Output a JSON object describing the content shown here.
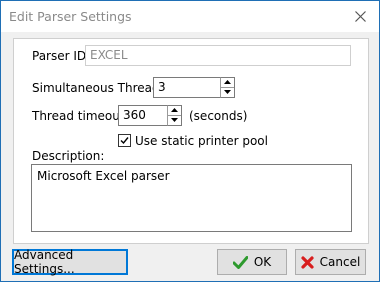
{
  "window": {
    "title": "Edit Parser Settings"
  },
  "icons": {
    "close": "close-icon",
    "ok": "check-icon",
    "cancel": "x-icon"
  },
  "colors": {
    "accent": "#0078d7",
    "ok_green": "#2e9a2e",
    "cancel_red": "#d81e1e"
  },
  "form": {
    "parser_id_label": "Parser ID:",
    "parser_id_value": "EXCEL",
    "threads_label": "Simultaneous Threads:",
    "threads_value": "3",
    "timeout_label": "Thread timeout:",
    "timeout_value": "360",
    "timeout_unit": "(seconds)",
    "static_pool_label": "Use static printer pool",
    "static_pool_checked": true,
    "description_label": "Description:",
    "description_value": "Microsoft Excel parser"
  },
  "buttons": {
    "advanced": "Advanced Settings...",
    "ok": "OK",
    "cancel": "Cancel"
  }
}
